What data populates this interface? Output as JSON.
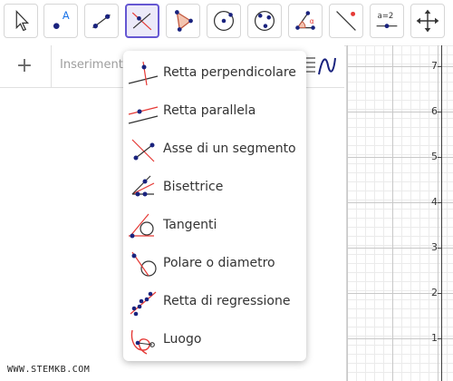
{
  "toolbar": {
    "tools": [
      {
        "name": "move-tool"
      },
      {
        "name": "point-tool",
        "label": "A"
      },
      {
        "name": "line-tool"
      },
      {
        "name": "perpendicular-line-tool"
      },
      {
        "name": "polygon-tool"
      },
      {
        "name": "circle-center-point-tool"
      },
      {
        "name": "circle-three-points-tool"
      },
      {
        "name": "angle-tool",
        "label": "α"
      },
      {
        "name": "reflect-tool"
      },
      {
        "name": "slider-tool",
        "label": "a=2"
      },
      {
        "name": "move-graphics-view-tool"
      }
    ]
  },
  "algebra": {
    "plus": "+",
    "input_placeholder": "Inserimento"
  },
  "graphics": {
    "y_ticks": [
      "7",
      "6",
      "5",
      "4",
      "3",
      "2",
      "1"
    ]
  },
  "menu": {
    "items": [
      {
        "label": "Retta perpendicolare",
        "icon": "perpendicular-line-icon"
      },
      {
        "label": "Retta parallela",
        "icon": "parallel-line-icon"
      },
      {
        "label": "Asse di un segmento",
        "icon": "perpendicular-bisector-icon"
      },
      {
        "label": "Bisettrice",
        "icon": "angle-bisector-icon"
      },
      {
        "label": "Tangenti",
        "icon": "tangents-icon"
      },
      {
        "label": "Polare o diametro",
        "icon": "polar-diameter-icon"
      },
      {
        "label": "Retta di regressione",
        "icon": "best-fit-line-icon"
      },
      {
        "label": "Luogo",
        "icon": "locus-icon"
      }
    ]
  },
  "watermark": "WWW.STEMKB.COM",
  "colors": {
    "accent": "#6557d2",
    "point": "#1a237e",
    "line": "#e53935"
  }
}
